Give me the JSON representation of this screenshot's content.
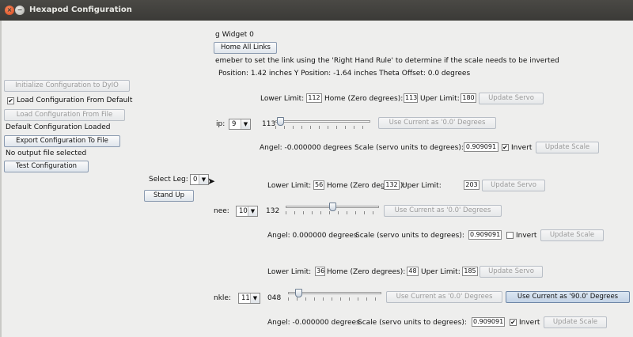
{
  "window": {
    "title": "Hexapod Configuration",
    "close_glyph": "×",
    "min_glyph": "−"
  },
  "left": {
    "init_button": "Initialize Configuration to DyIO",
    "load_default_label": "Load Configuration From Default",
    "load_default_checked": true,
    "load_file_button": "Load Configuration From File",
    "default_status": "Default Configuration Loaded",
    "export_button": "Export Configuration To File",
    "output_status": "No output file selected",
    "test_button": "Test Configuration"
  },
  "leg": {
    "label": "Select Leg:",
    "value": "0",
    "stand_up": "Stand Up"
  },
  "top": {
    "widget_title": "g Widget 0",
    "home_all": "Home All Links",
    "reminder": "emeber to set the link using the 'Right Hand Rule' to determine if the scale needs to be inverted",
    "position": "Position: 1.42 inches Y Position: -1.64 inches Theta Offset: 0.0 degrees"
  },
  "common": {
    "lower_limit": "Lower Limit:",
    "home": "Home (Zero degrees):",
    "uper_limit": "Uper Limit:",
    "update_servo": "Update Servo",
    "scale_label": "Scale (servo units to degrees):",
    "invert": "Invert",
    "update_scale": "Update Scale",
    "use_zero": "Use Current as '0.0' Degrees",
    "use_ninety": "Use Current as '90.0' Degrees",
    "check_mark": "✔",
    "arrow": "▼"
  },
  "links": [
    {
      "name": "ip:",
      "channel": "9",
      "lower": "112",
      "home": "113",
      "upper": "180",
      "slider_value": "113",
      "slider_fraction": 0.02,
      "angle_text": "Angel: -0.000000 degrees",
      "scale": "0.909091",
      "invert": true
    },
    {
      "name": "nee:",
      "channel": "10",
      "lower": "56",
      "home": "132",
      "upper": "203",
      "slider_value": "132",
      "slider_fraction": 0.5,
      "angle_text": "Angel: 0.000000 degrees",
      "scale": "0.909091",
      "invert": false
    },
    {
      "name": "nkle:",
      "channel": "11",
      "lower": "36",
      "home": "48",
      "upper": "185",
      "slider_value": "048",
      "slider_fraction": 0.08,
      "angle_text": "Angel: -0.000000 degrees",
      "scale": "0.909091",
      "invert": true
    }
  ]
}
